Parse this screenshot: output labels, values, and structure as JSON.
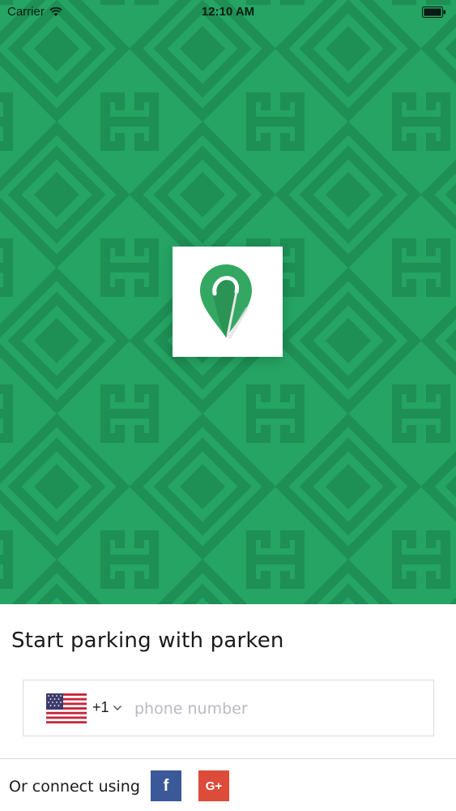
{
  "status_bar": {
    "carrier": "Carrier",
    "time": "12:10 AM"
  },
  "hero": {
    "background_color": "#25a463",
    "pattern_color": "#1e8f55",
    "logo_icon": "map-pin-icon",
    "logo_color": "#34a863"
  },
  "signup": {
    "tagline": "Start parking with parken",
    "country_flag": "us-flag-icon",
    "dial_code": "+1",
    "phone_placeholder": "phone number",
    "phone_value": ""
  },
  "social": {
    "label": "Or connect using",
    "facebook_label": "f",
    "facebook_color": "#3b5998",
    "google_label": "G+",
    "google_color": "#dd4b39"
  }
}
